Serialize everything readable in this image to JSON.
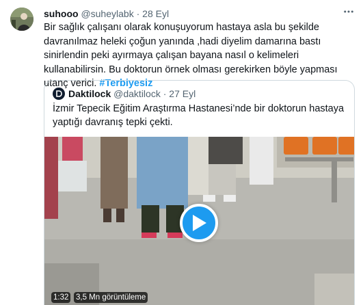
{
  "tweet": {
    "author_name": "suhooo",
    "author_handle": "@suheylabk",
    "separator": "·",
    "date": "28 Eyl",
    "text": "Bir sağlık çalışanı olarak konuşuyorum hastaya asla bu şekilde davranılmaz heleki çoğun yanında ,hadi diyelim damarına bastı sinirlendin peki ayırmaya çalışan bayana nasıl o kelimeleri kullanabilirsin. Bu doktorun örnek olması gerekirken böyle yapması utanç verici.",
    "hashtag": "#Terbiyesiz"
  },
  "quoted": {
    "author_name": "Daktilock",
    "author_handle": "@daktilock",
    "separator": "·",
    "date": "27 Eyl",
    "text": "İzmir Tepecik Eğitim Araştırma Hastanesi’nde bir doktorun hastaya yaptığı davranış tepki çekti.",
    "video": {
      "duration": "1:32",
      "views": "3,5 Mn görüntüleme"
    }
  },
  "icons": {
    "more": "more-icon",
    "play": "play-icon",
    "quoted_avatar": "daktilock-logo-icon"
  },
  "colors": {
    "link": "#1d9bf0",
    "secondary_text": "#536471",
    "border": "#cfd9de",
    "play_button": "#1d9bf0"
  }
}
